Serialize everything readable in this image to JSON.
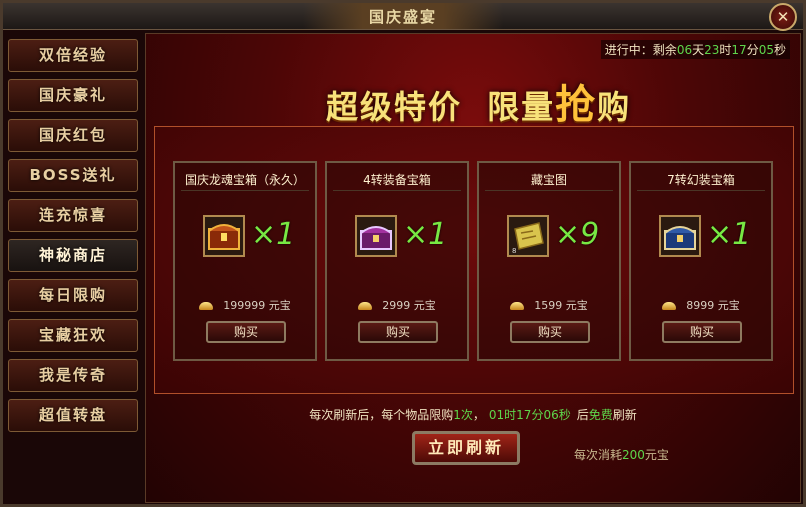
{
  "window": {
    "title": "国庆盛宴",
    "close_icon": "close-icon"
  },
  "sidebar": {
    "items": [
      {
        "label": "双倍经验"
      },
      {
        "label": "国庆豪礼"
      },
      {
        "label": "国庆红包"
      },
      {
        "label": "BOSS送礼"
      },
      {
        "label": "连充惊喜"
      },
      {
        "label": "神秘商店",
        "active": true
      },
      {
        "label": "每日限购"
      },
      {
        "label": "宝藏狂欢"
      },
      {
        "label": "我是传奇"
      },
      {
        "label": "超值转盘"
      }
    ]
  },
  "status": {
    "prefix": "进行中：剩余",
    "days": "06",
    "days_unit": "天",
    "hours": "23",
    "hours_unit": "时",
    "minutes": "17",
    "minutes_unit": "分",
    "seconds": "05",
    "seconds_unit": "秒"
  },
  "banner": {
    "part1": "超级特价",
    "part2a": "限量",
    "part2b": "抢",
    "part2c": "购"
  },
  "items": [
    {
      "name": "国庆龙魂宝箱（永久）",
      "qty": "×1",
      "price": "199999",
      "currency": "元宝",
      "buy_label": "购买",
      "icon": "gold-chest-icon",
      "icon_color": "#c2541a"
    },
    {
      "name": "4转装备宝箱",
      "qty": "×1",
      "price": "2999",
      "currency": "元宝",
      "buy_label": "购买",
      "icon": "purple-chest-icon",
      "icon_color": "#a2319f"
    },
    {
      "name": "藏宝图",
      "qty": "×9",
      "price": "1599",
      "currency": "元宝",
      "buy_label": "购买",
      "icon": "treasure-map-icon",
      "icon_color": "#d9c44d"
    },
    {
      "name": "7转幻装宝箱",
      "qty": "×1",
      "price": "8999",
      "currency": "元宝",
      "buy_label": "购买",
      "icon": "blue-chest-icon",
      "icon_color": "#2f5aa8"
    }
  ],
  "info": {
    "part1": "每次刷新后，每个物品限购",
    "limit": "1次",
    "timer": "01时17分06秒",
    "part2": "后",
    "free": "免费",
    "part3": "刷新"
  },
  "refresh": {
    "label": "立即刷新",
    "cost_prefix": "每次消耗",
    "cost_value": "200",
    "cost_suffix": "元宝"
  }
}
